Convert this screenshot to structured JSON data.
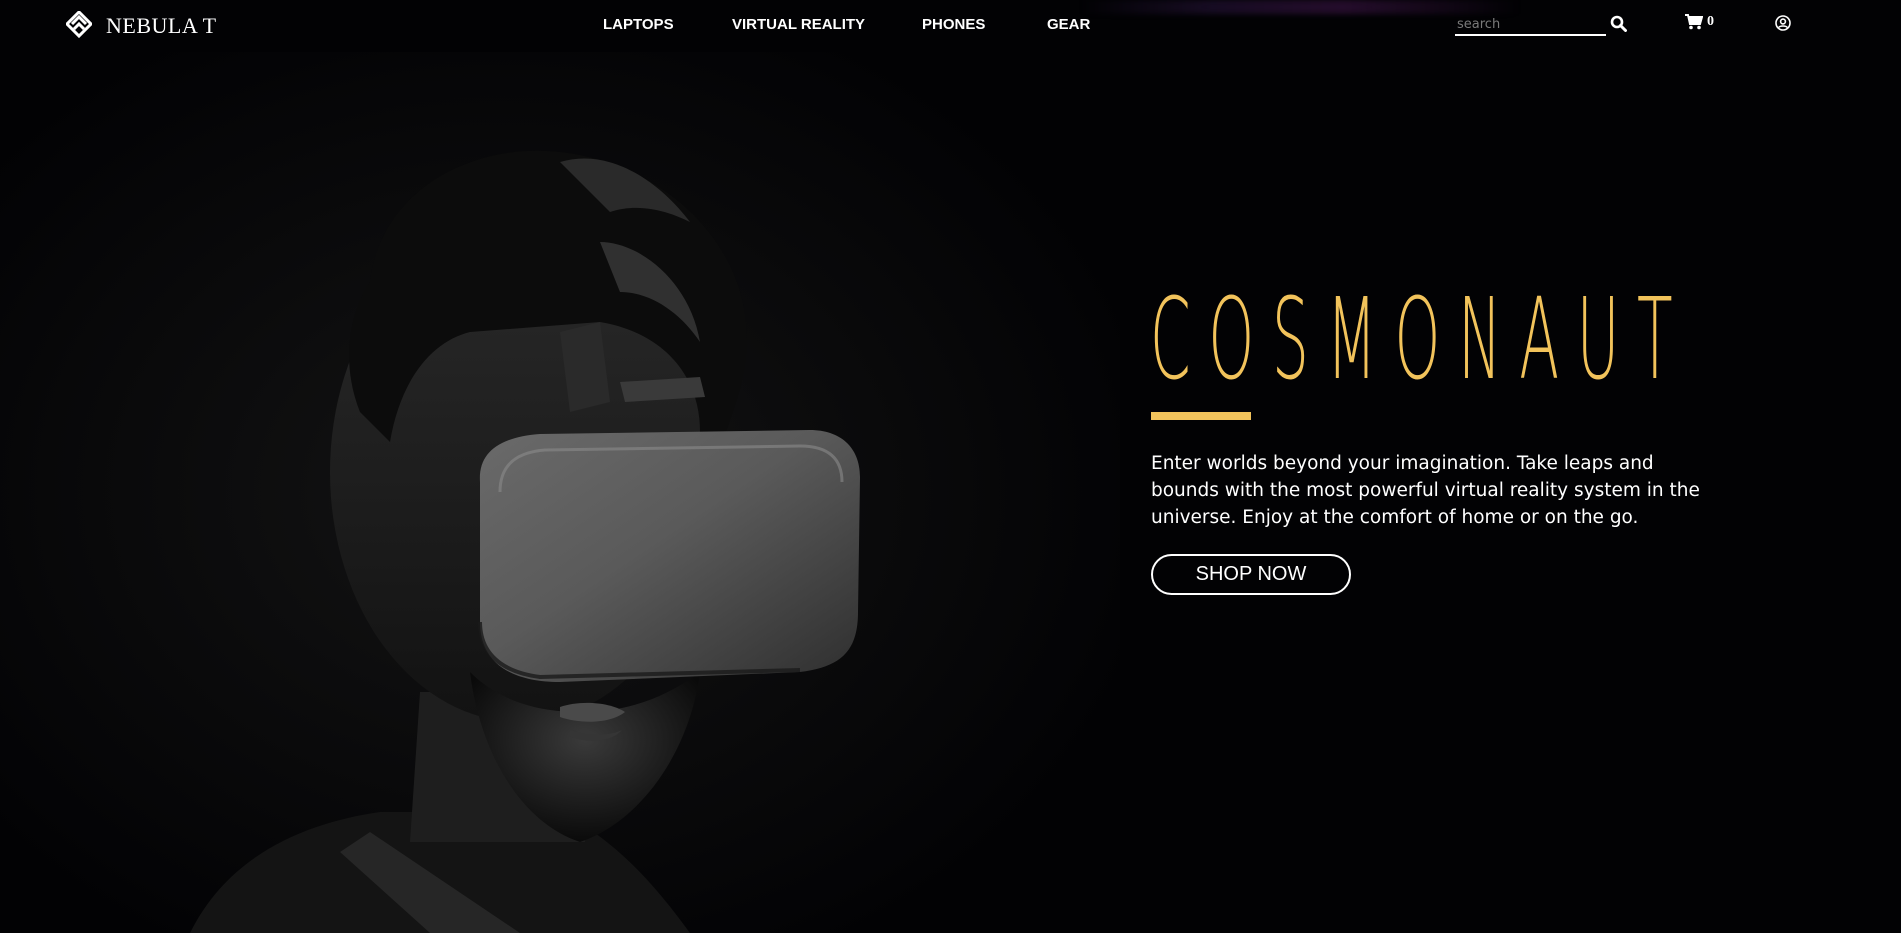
{
  "brand": {
    "name": "NEBULA T",
    "logo_icon": "diamond-logo-icon"
  },
  "nav": {
    "links": [
      {
        "label": "LAPTOPS"
      },
      {
        "label": "VIRTUAL REALITY"
      },
      {
        "label": "PHONES"
      },
      {
        "label": "GEAR"
      }
    ]
  },
  "search": {
    "placeholder": "search",
    "value": "",
    "icon": "search-icon"
  },
  "cart": {
    "icon": "cart-icon",
    "count": "0"
  },
  "account": {
    "icon": "user-circle-icon"
  },
  "hero": {
    "title": "COSMONAUT",
    "description": "Enter worlds beyond your imagination. Take leaps and bounds with the most powerful virtual reality system in the universe. Enjoy at the comfort of home or on the go.",
    "cta_label": "SHOP NOW",
    "accent_color": "#f2c35b",
    "image": "person-wearing-vr-headset-photo"
  }
}
